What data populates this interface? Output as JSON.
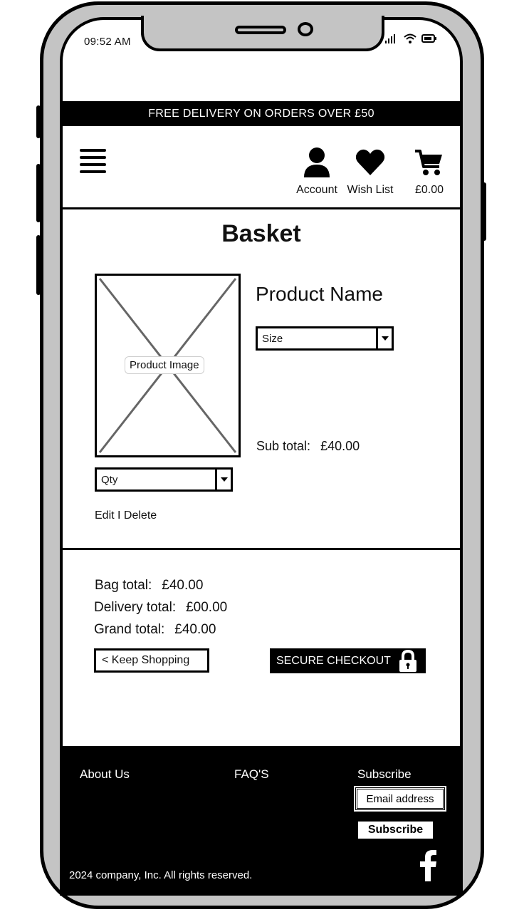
{
  "status_bar": {
    "time": "09:52 AM"
  },
  "promo_banner": "FREE DELIVERY ON ORDERS OVER £50",
  "header": {
    "account_label": "Account",
    "wishlist_label": "Wish List",
    "basket_total": "£0.00"
  },
  "page_title": "Basket",
  "product": {
    "image_label": "Product Image",
    "name": "Product Name",
    "size_select": "Size",
    "qty_select": "Qty",
    "subtotal_label": "Sub total:",
    "subtotal_value": "£40.00",
    "edit_delete": "Edit I Delete"
  },
  "totals": {
    "bag_label": "Bag total:",
    "bag_value": "£40.00",
    "delivery_label": "Delivery total:",
    "delivery_value": "£00.00",
    "grand_label": "Grand total:",
    "grand_value": "£40.00"
  },
  "buttons": {
    "keep_shopping": "< Keep Shopping",
    "secure_checkout": "SECURE CHECKOUT"
  },
  "footer": {
    "about": "About Us",
    "faq": "FAQ'S",
    "subscribe_heading": "Subscribe",
    "email_placeholder": "Email address",
    "subscribe_button": "Subscribe",
    "copyright": "2024 company, Inc. All rights reserved."
  },
  "icons": [
    "menu-icon",
    "account-icon",
    "heart-icon",
    "cart-icon",
    "lock-icon",
    "facebook-icon",
    "signal-icon",
    "wifi-icon",
    "battery-icon",
    "chevron-down-icon"
  ],
  "colors": {
    "frame": "#c4c4c4",
    "ink": "#000000",
    "paper": "#ffffff"
  }
}
